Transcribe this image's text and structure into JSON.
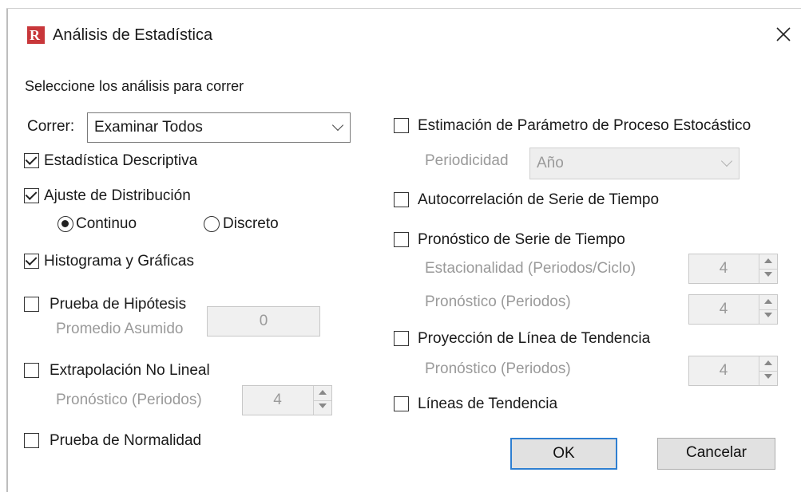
{
  "window": {
    "title": "Análisis de Estadística"
  },
  "instruction": "Seleccione los análisis para correr",
  "run": {
    "label": "Correr:",
    "selected": "Examinar Todos"
  },
  "left": {
    "descriptive": {
      "label": "Estadística Descriptiva",
      "checked": true
    },
    "distribution_fit": {
      "label": "Ajuste de Distribución",
      "checked": true,
      "continuous_label": "Continuo",
      "discrete_label": "Discreto",
      "selected": "Continuo"
    },
    "histogram": {
      "label": "Histograma y Gráficas",
      "checked": true
    },
    "hypothesis": {
      "label": "Prueba de Hipótesis",
      "checked": false,
      "assumed_mean_label": "Promedio Asumido",
      "assumed_mean_value": "0"
    },
    "nonlinear": {
      "label": "Extrapolación No Lineal",
      "checked": false,
      "forecast_label": "Pronóstico (Periodos)",
      "forecast_value": "4"
    },
    "normality": {
      "label": "Prueba de Normalidad",
      "checked": false
    }
  },
  "right": {
    "stochastic": {
      "label": "Estimación de Parámetro de Proceso Estocástico",
      "checked": false,
      "periodicity_label": "Periodicidad",
      "periodicity_value": "Año"
    },
    "autocorrelation": {
      "label": "Autocorrelación de Serie de Tiempo",
      "checked": false
    },
    "ts_forecast": {
      "label": "Pronóstico de Serie de Tiempo",
      "checked": false,
      "seasonality_label": "Estacionalidad (Periodos/Ciclo)",
      "seasonality_value": "4",
      "forecast_label": "Pronóstico (Periodos)",
      "forecast_value": "4"
    },
    "trendline_projection": {
      "label": "Proyección de Línea de Tendencia",
      "checked": false,
      "forecast_label": "Pronóstico (Periodos)",
      "forecast_value": "4"
    },
    "trendlines": {
      "label": "Líneas de Tendencia",
      "checked": false
    }
  },
  "buttons": {
    "ok": "OK",
    "cancel": "Cancelar"
  }
}
